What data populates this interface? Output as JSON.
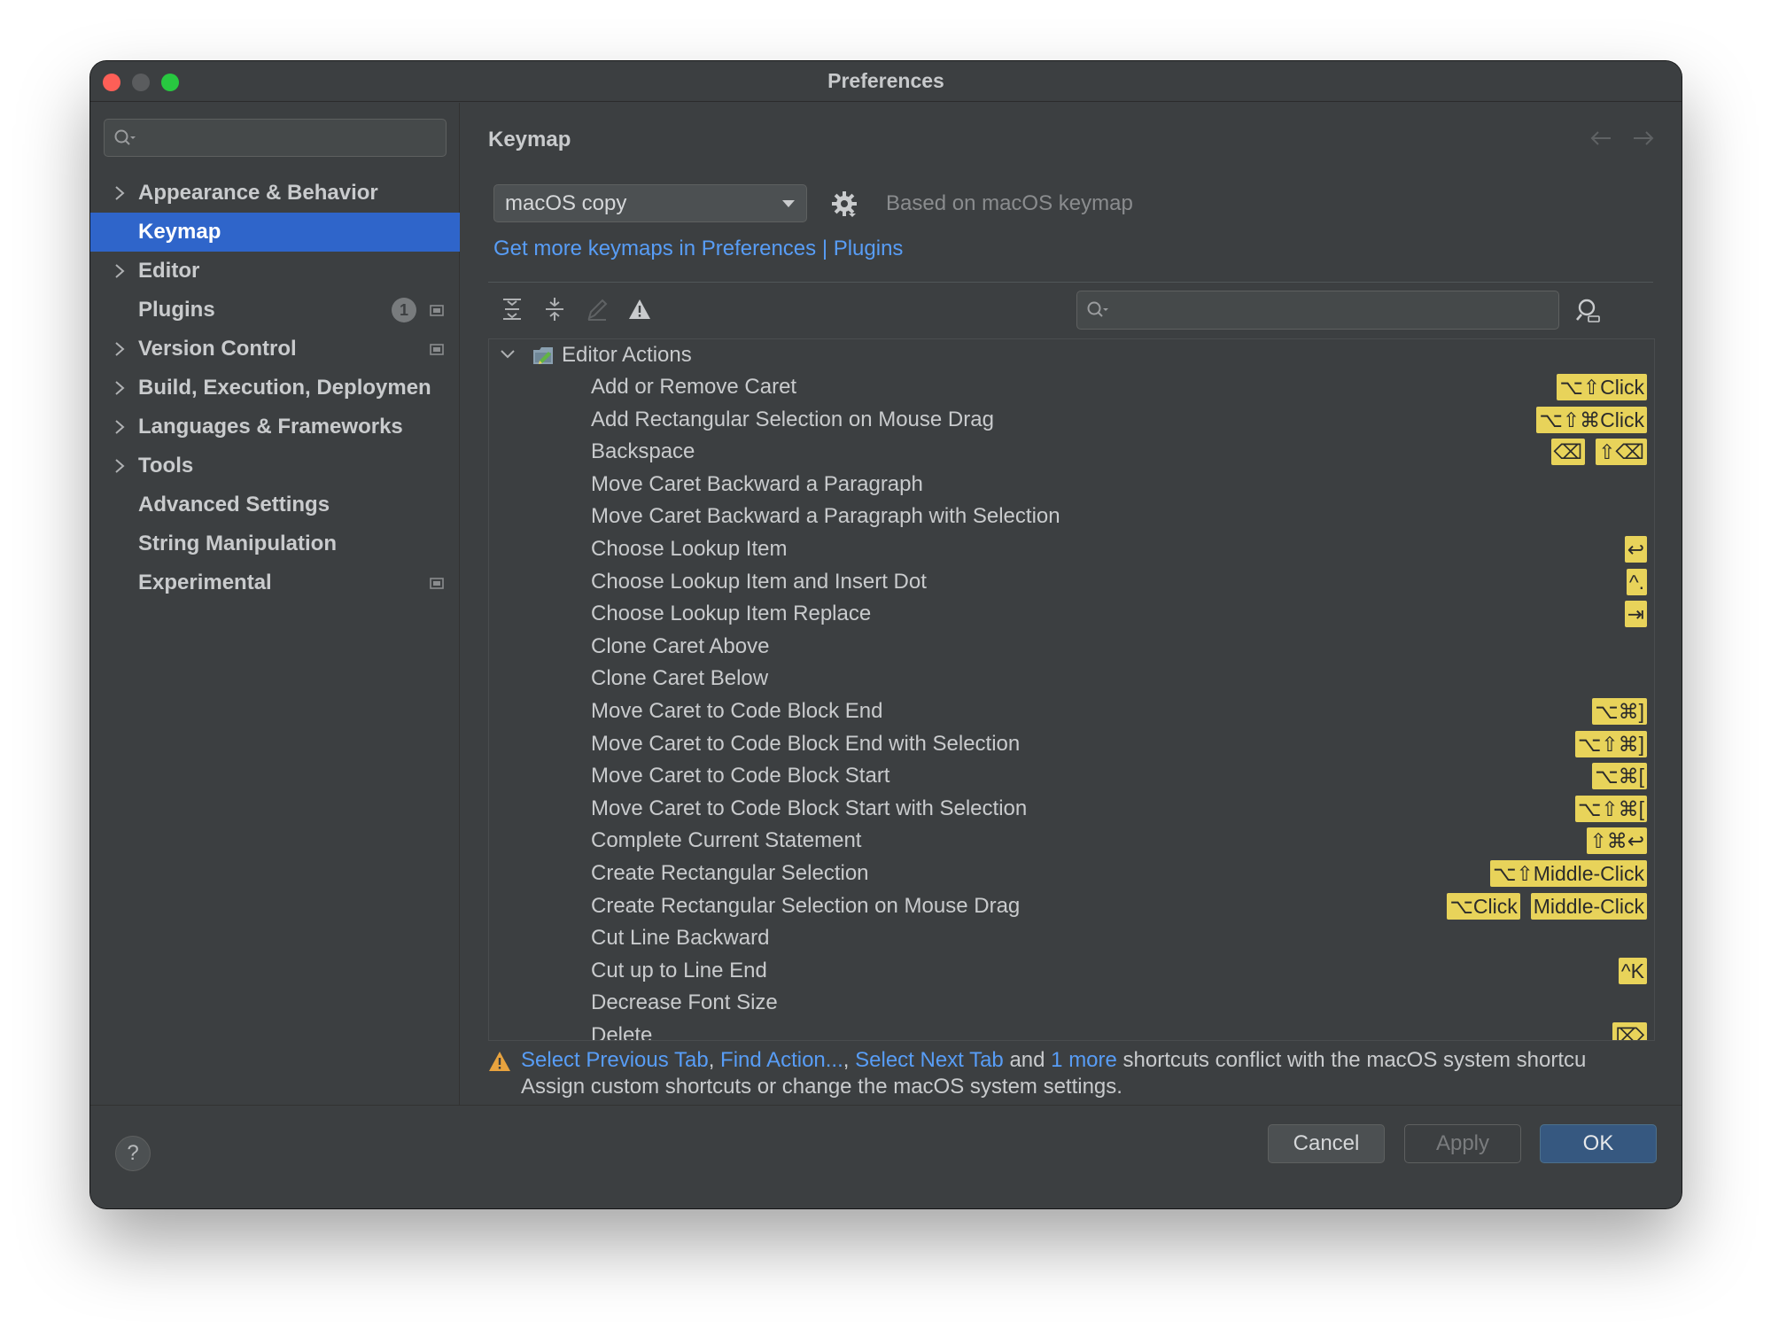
{
  "window": {
    "title": "Preferences"
  },
  "sidebar": {
    "search_placeholder": "",
    "items": [
      {
        "label": "Appearance & Behavior",
        "expandable": true
      },
      {
        "label": "Keymap",
        "expandable": false,
        "selected": true
      },
      {
        "label": "Editor",
        "expandable": true
      },
      {
        "label": "Plugins",
        "expandable": false,
        "badge": "1",
        "project_icon": true
      },
      {
        "label": "Version Control",
        "expandable": true,
        "project_icon": true
      },
      {
        "label": "Build, Execution, Deploymen",
        "expandable": true
      },
      {
        "label": "Languages & Frameworks",
        "expandable": true
      },
      {
        "label": "Tools",
        "expandable": true
      },
      {
        "label": "Advanced Settings",
        "expandable": false
      },
      {
        "label": "String Manipulation",
        "expandable": false
      },
      {
        "label": "Experimental",
        "expandable": false,
        "project_icon": true
      }
    ]
  },
  "main": {
    "title": "Keymap",
    "keymap_select": "macOS copy",
    "based_on": "Based on macOS keymap",
    "get_more_link": "Get more keymaps in Preferences | Plugins",
    "tree_search_placeholder": "",
    "tree": {
      "group": "Editor Actions",
      "rows": [
        {
          "label": "Add or Remove Caret",
          "shortcuts": [
            "⌥⇧Click"
          ]
        },
        {
          "label": "Add Rectangular Selection on Mouse Drag",
          "shortcuts": [
            "⌥⇧⌘Click"
          ]
        },
        {
          "label": "Backspace",
          "shortcuts": [
            "⌫",
            "⇧⌫"
          ]
        },
        {
          "label": "Move Caret Backward a Paragraph",
          "shortcuts": []
        },
        {
          "label": "Move Caret Backward a Paragraph with Selection",
          "shortcuts": []
        },
        {
          "label": "Choose Lookup Item",
          "shortcuts": [
            "↩"
          ]
        },
        {
          "label": "Choose Lookup Item and Insert Dot",
          "shortcuts": [
            "^."
          ]
        },
        {
          "label": "Choose Lookup Item Replace",
          "shortcuts": [
            "⇥"
          ]
        },
        {
          "label": "Clone Caret Above",
          "shortcuts": []
        },
        {
          "label": "Clone Caret Below",
          "shortcuts": []
        },
        {
          "label": "Move Caret to Code Block End",
          "shortcuts": [
            "⌥⌘]"
          ]
        },
        {
          "label": "Move Caret to Code Block End with Selection",
          "shortcuts": [
            "⌥⇧⌘]"
          ]
        },
        {
          "label": "Move Caret to Code Block Start",
          "shortcuts": [
            "⌥⌘["
          ]
        },
        {
          "label": "Move Caret to Code Block Start with Selection",
          "shortcuts": [
            "⌥⇧⌘["
          ]
        },
        {
          "label": "Complete Current Statement",
          "shortcuts": [
            "⇧⌘↩"
          ]
        },
        {
          "label": "Create Rectangular Selection",
          "shortcuts": [
            "⌥⇧Middle-Click"
          ]
        },
        {
          "label": "Create Rectangular Selection on Mouse Drag",
          "shortcuts": [
            "⌥Click",
            "Middle-Click"
          ]
        },
        {
          "label": "Cut Line Backward",
          "shortcuts": []
        },
        {
          "label": "Cut up to Line End",
          "shortcuts": [
            "^K"
          ]
        },
        {
          "label": "Decrease Font Size",
          "shortcuts": []
        },
        {
          "label": "Delete",
          "shortcuts": [
            "⌦"
          ]
        }
      ]
    },
    "warning": {
      "link1": "Select Previous Tab",
      "sep1": ", ",
      "link2": "Find Action...",
      "sep2": ", ",
      "link3": "Select Next Tab",
      "sep3": " and ",
      "link4": "1 more",
      "tail": " shortcuts conflict with the macOS system shortcu",
      "line2": "Assign custom shortcuts or change the macOS system settings."
    }
  },
  "footer": {
    "help": "?",
    "cancel": "Cancel",
    "apply": "Apply",
    "ok": "OK"
  },
  "colors": {
    "accent": "#2f65ca",
    "link": "#589df6",
    "shortcut_bg": "#e8d35a",
    "window_bg": "#3c3f41",
    "ok_bg": "#365880"
  }
}
